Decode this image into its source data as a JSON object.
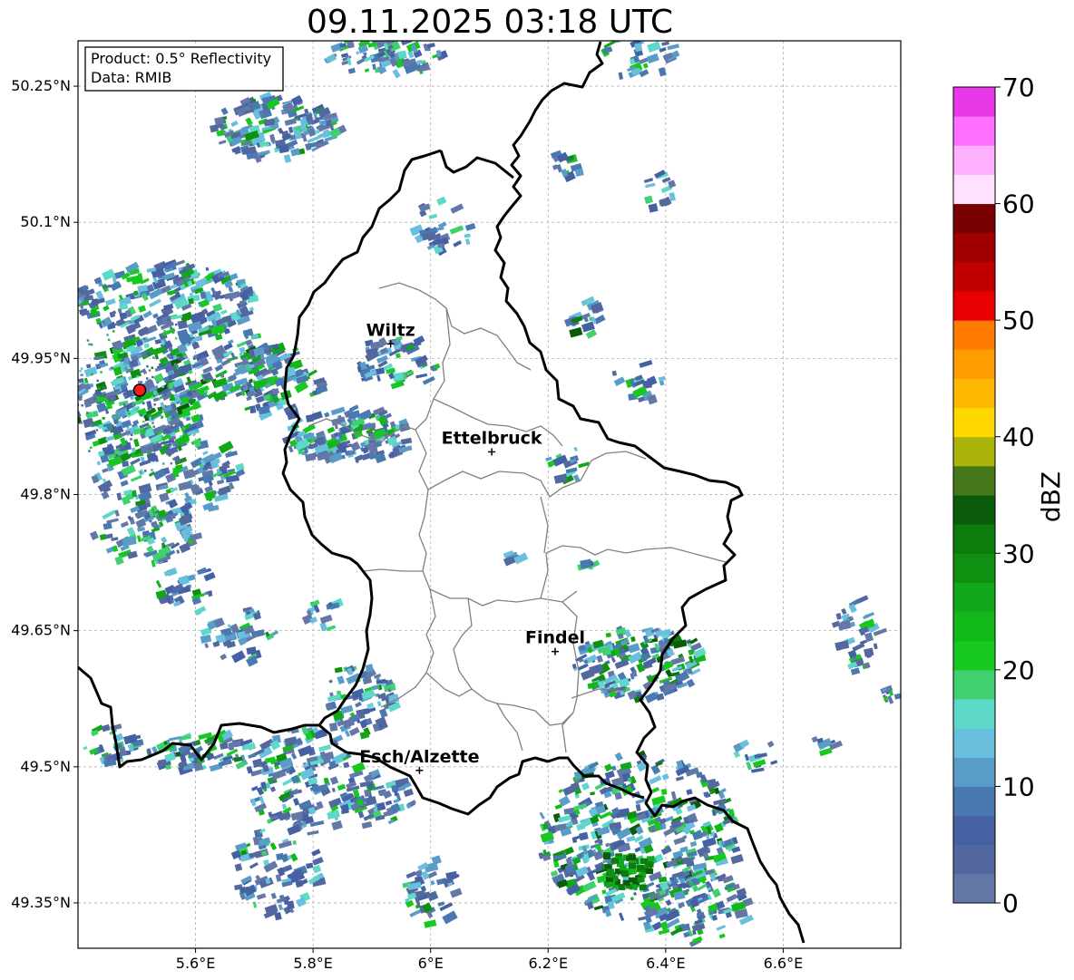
{
  "title": "09.11.2025 03:18 UTC",
  "info_box": {
    "product": "Product: 0.5° Reflectivity",
    "data": "Data: RMIB"
  },
  "map": {
    "lon_range": [
      5.4,
      6.8
    ],
    "lat_range": [
      49.3,
      50.3
    ],
    "x_ticks": [
      {
        "value": 5.6,
        "label": "5.6°E"
      },
      {
        "value": 5.8,
        "label": "5.8°E"
      },
      {
        "value": 6.0,
        "label": "6°E"
      },
      {
        "value": 6.2,
        "label": "6.2°E"
      },
      {
        "value": 6.4,
        "label": "6.4°E"
      },
      {
        "value": 6.6,
        "label": "6.6°E"
      }
    ],
    "y_ticks": [
      {
        "value": 49.35,
        "label": "49.35°N"
      },
      {
        "value": 49.5,
        "label": "49.5°N"
      },
      {
        "value": 49.65,
        "label": "49.65°N"
      },
      {
        "value": 49.8,
        "label": "49.8°N"
      },
      {
        "value": 49.95,
        "label": "49.95°N"
      },
      {
        "value": 50.1,
        "label": "50.1°N"
      },
      {
        "value": 50.25,
        "label": "50.25°N"
      }
    ],
    "cities": [
      {
        "name": "Wiltz",
        "lon": 5.932,
        "lat": 49.966
      },
      {
        "name": "Ettelbruck",
        "lon": 6.104,
        "lat": 49.847
      },
      {
        "name": "Findel",
        "lon": 6.212,
        "lat": 49.627
      },
      {
        "name": "Esch/Alzette",
        "lon": 5.981,
        "lat": 49.496
      }
    ],
    "radar_site": {
      "lon": 5.505,
      "lat": 49.915,
      "color": "#ff1a1a"
    }
  },
  "colorbar": {
    "label": "dBZ",
    "vmin": 0,
    "vmax": 70,
    "step": 2.5,
    "ticks": [
      0,
      10,
      20,
      30,
      40,
      50,
      60,
      70
    ],
    "colors": [
      "#6478a8",
      "#5468a0",
      "#4660a4",
      "#4a78b0",
      "#5a9cc8",
      "#68c0dc",
      "#5ed8c8",
      "#40d070",
      "#16c820",
      "#12b818",
      "#10a818",
      "#109010",
      "#0c7c0c",
      "#0a5c0a",
      "#46781a",
      "#aab40a",
      "#ffd800",
      "#ffb800",
      "#ff9c00",
      "#ff7c00",
      "#e80000",
      "#c00000",
      "#a00000",
      "#780000",
      "#ffe0ff",
      "#ffb0ff",
      "#ff70ff",
      "#e838e8"
    ]
  }
}
